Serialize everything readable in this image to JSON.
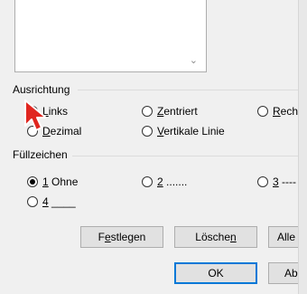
{
  "alignment": {
    "title": "Ausrichtung",
    "options": [
      {
        "label_pre": "",
        "mnemonic": "L",
        "label_post": "inks",
        "checked": true
      },
      {
        "label_pre": "",
        "mnemonic": "Z",
        "label_post": "entriert",
        "checked": false
      },
      {
        "label_pre": "",
        "mnemonic": "R",
        "label_post": "ech",
        "checked": false
      },
      {
        "label_pre": "",
        "mnemonic": "D",
        "label_post": "ezimal",
        "checked": false
      },
      {
        "label_pre": "",
        "mnemonic": "V",
        "label_post": "ertikale Linie",
        "checked": false
      }
    ]
  },
  "leader": {
    "title": "Füllzeichen",
    "options": [
      {
        "mnemonic": "1",
        "label_post": " Ohne",
        "checked": true
      },
      {
        "mnemonic": "2",
        "label_post": " .......",
        "checked": false
      },
      {
        "mnemonic": "3",
        "label_post": " ----",
        "checked": false
      },
      {
        "mnemonic": "4",
        "label_post": " ____",
        "checked": false
      }
    ]
  },
  "buttons": {
    "set": {
      "pre": "F",
      "mn": "e",
      "post": "stlegen"
    },
    "clear": {
      "pre": "Lösche",
      "mn": "n",
      "post": ""
    },
    "clear_all": "Alle",
    "ok": "OK",
    "cancel": "Ab"
  },
  "list_scroll_icon": "chevron-down-icon",
  "cursor_icon": "mouse-pointer-icon"
}
